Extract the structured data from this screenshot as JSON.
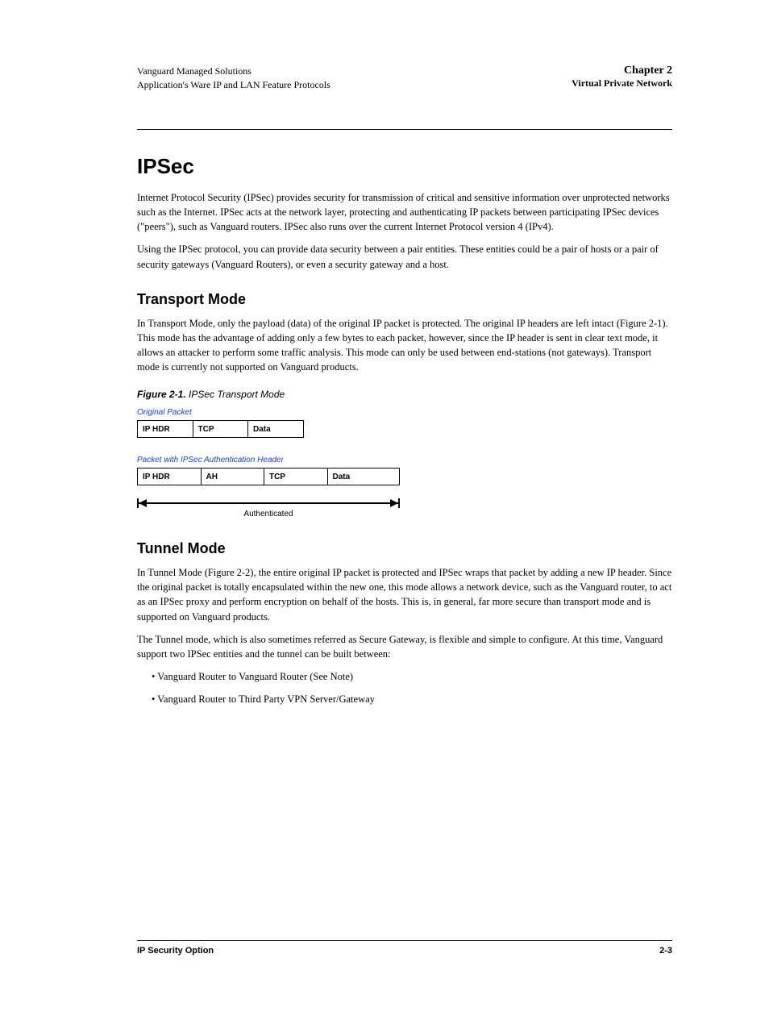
{
  "header": {
    "left_line1": "Vanguard Managed Solutions",
    "left_line2": "Application's Ware IP and LAN Feature Protocols",
    "chapter_label": "Chapter 2",
    "chapter_title": "Virtual Private Network"
  },
  "section": {
    "title": "IPSec",
    "p1": "Internet Protocol Security (IPSec) provides security for transmission of critical and sensitive information over unprotected networks such as the Internet. IPSec acts at the network layer, protecting and authenticating IP packets between participating IPSec devices (\"peers\"), such as Vanguard routers. IPSec also runs over the current Internet Protocol version 4 (IPv4).",
    "p2": "Using the IPSec protocol, you can provide data security between a pair entities. These entities could be a pair of hosts or a pair of security gateways (Vanguard Routers), or even a security gateway and a host."
  },
  "transport": {
    "title": "Transport Mode",
    "p1": "In Transport Mode, only the payload (data) of the original IP packet is protected. The original IP headers are left intact (Figure 2-1). This mode has the advantage of adding only a few bytes to each packet, however, since the IP header is sent in clear text mode, it allows an attacker to perform some traffic analysis. This mode can only be used between end-stations (not gateways). Transport mode is currently not supported on Vanguard products.",
    "fig_id": "Figure 2-1.",
    "fig_title": "IPSec Transport Mode",
    "diag": {
      "label1": "Original Packet",
      "orig": [
        "IP HDR",
        "TCP",
        "Data"
      ],
      "label2": "Packet with IPSec Authentication Header",
      "ipsec": [
        "IP HDR",
        "AH",
        "TCP",
        "Data"
      ],
      "arrow_label": "Authenticated"
    }
  },
  "tunnel": {
    "title": "Tunnel Mode",
    "p1": "In Tunnel Mode (Figure 2-2), the entire original IP packet is protected and IPSec wraps that packet by adding a new IP header. Since the original packet is totally encapsulated within the new one, this mode allows a network device, such as the Vanguard router, to act as an IPSec proxy and perform encryption on behalf of the hosts. This is, in general, far more secure than transport mode and is supported on Vanguard products.",
    "p2": "The Tunnel mode, which is also sometimes referred as Secure Gateway, is flexible and simple to configure. At this time, Vanguard support two IPSec entities and the tunnel can be built between:",
    "li1": "Vanguard Router to Vanguard Router (See Note)",
    "li2": "Vanguard Router to Third Party VPN Server/Gateway"
  },
  "footer": {
    "left": "IP Security Option",
    "right": "2-3"
  }
}
